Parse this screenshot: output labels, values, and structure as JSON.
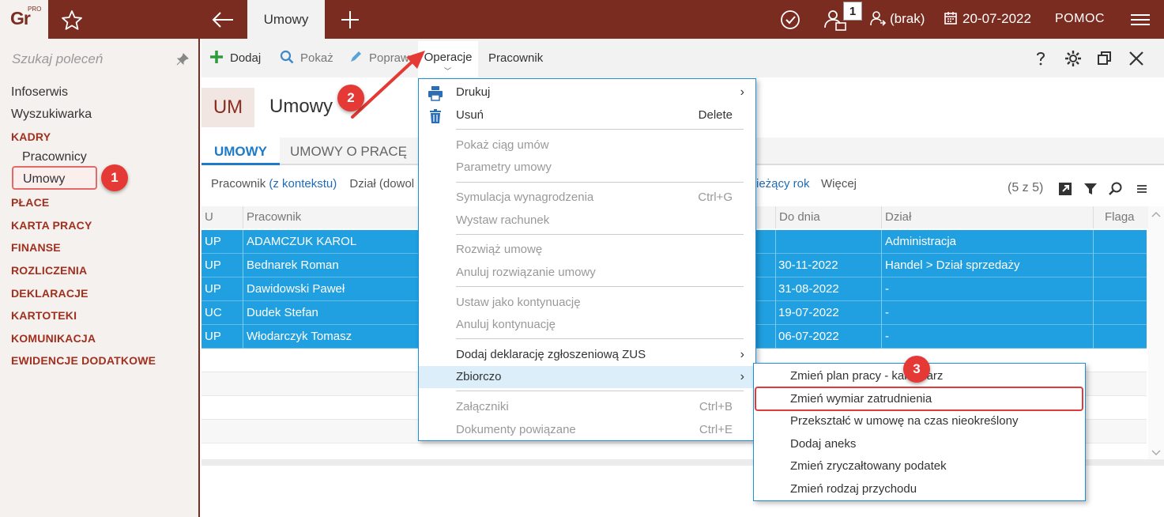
{
  "topbar": {
    "logo": "Gr",
    "logo_sup": "PRO",
    "active_tab": "Umowy",
    "badge_count": "1",
    "operator": "(brak)",
    "date": "20-07-2022",
    "help": "POMOC"
  },
  "sidebar": {
    "search_placeholder": "Szukaj poleceń",
    "items": [
      {
        "label": "Infoserwis"
      },
      {
        "label": "Wyszukiwarka"
      }
    ],
    "sections": {
      "kadry": "KADRY",
      "kadry_sub1": "Pracownicy",
      "kadry_sub2": "Umowy",
      "place": "PŁACE",
      "karta": "KARTA PRACY",
      "finanse": "FINANSE",
      "rozliczenia": "ROZLICZENIA",
      "deklaracje": "DEKLARACJE",
      "kartoteki": "KARTOTEKI",
      "komunikacja": "KOMUNIKACJA",
      "ewidencje": "EWIDENCJE DODATKOWE"
    }
  },
  "toolbar": {
    "add": "Dodaj",
    "show": "Pokaż",
    "edit": "Popraw",
    "operations": "Operacje",
    "employee": "Pracownik"
  },
  "page": {
    "badge": "UM",
    "title": "Umowy",
    "tab_active": "UMOWY",
    "tab_inactive": "UMOWY O PRACĘ"
  },
  "filters": {
    "employee_label": "Pracownik",
    "employee_link": "(z kontekstu)",
    "dept": "Dział (dowol",
    "year": "ieżący rok",
    "more": "Więcej",
    "count": "(5 z 5)"
  },
  "grid": {
    "headers": {
      "u": "U",
      "employee": "Pracownik",
      "to_date": "Do dnia",
      "dept": "Dział",
      "flag": "Flaga"
    },
    "rows": [
      {
        "u": "UP",
        "employee": "ADAMCZUK KAROL",
        "to_date": "",
        "dept": "Administracja"
      },
      {
        "u": "UP",
        "employee": "Bednarek Roman",
        "to_date": "30-11-2022",
        "dept": "Handel > Dział sprzedaży"
      },
      {
        "u": "UP",
        "employee": "Dawidowski Paweł",
        "to_date": "31-08-2022",
        "dept": "-"
      },
      {
        "u": "UC",
        "employee": "Dudek Stefan",
        "to_date": "19-07-2022",
        "dept": "-"
      },
      {
        "u": "UP",
        "employee": "Włodarczyk Tomasz",
        "to_date": "06-07-2022",
        "dept": "-"
      }
    ]
  },
  "menu": {
    "print": "Drukuj",
    "delete": "Usuń",
    "delete_sc": "Delete",
    "show_chain": "Pokaż ciąg umów",
    "params": "Parametry umowy",
    "simulation": "Symulacja wynagrodzenia",
    "simulation_sc": "Ctrl+G",
    "bill": "Wystaw rachunek",
    "terminate": "Rozwiąż umowę",
    "cancel_terminate": "Anuluj rozwiązanie umowy",
    "set_continuation": "Ustaw jako kontynuację",
    "cancel_continuation": "Anuluj kontynuację",
    "zus": "Dodaj deklarację zgłoszeniową ZUS",
    "bulk": "Zbiorczo",
    "attachments": "Załączniki",
    "attachments_sc": "Ctrl+B",
    "related_docs": "Dokumenty powiązane",
    "related_docs_sc": "Ctrl+E"
  },
  "submenu": {
    "items": [
      "Zmień plan pracy - kalendarz",
      "Zmień wymiar zatrudnienia",
      "Przekształć w umowę na czas nieokreślony",
      "Dodaj aneks",
      "Zmień zryczałtowany podatek",
      "Zmień rodzaj przychodu"
    ]
  },
  "markers": {
    "m1": "1",
    "m2": "2",
    "m3": "3"
  },
  "colors": {
    "brand": "#7a2c21",
    "selection": "#20a0e0",
    "accent": "#1e7bc9",
    "marker": "#e53935"
  }
}
